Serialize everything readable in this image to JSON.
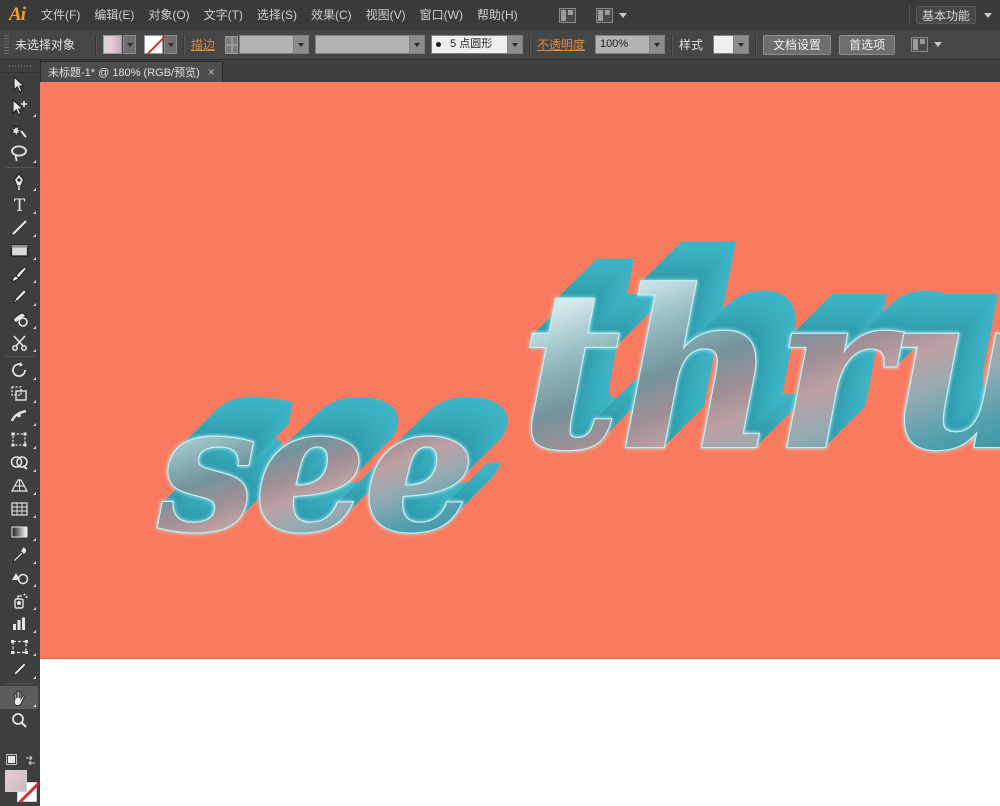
{
  "app": {
    "name": "Adobe Illustrator",
    "logo_text": "Ai"
  },
  "menubar": {
    "items": [
      {
        "label": "文件(F)",
        "name": "menu-file"
      },
      {
        "label": "编辑(E)",
        "name": "menu-edit"
      },
      {
        "label": "对象(O)",
        "name": "menu-object"
      },
      {
        "label": "文字(T)",
        "name": "menu-type"
      },
      {
        "label": "选择(S)",
        "name": "menu-select"
      },
      {
        "label": "效果(C)",
        "name": "menu-effect"
      },
      {
        "label": "视图(V)",
        "name": "menu-view"
      },
      {
        "label": "窗口(W)",
        "name": "menu-window"
      },
      {
        "label": "帮助(H)",
        "name": "menu-help"
      }
    ],
    "bridge_icon": "bridge-icon",
    "arrange_icon": "arrange-documents-icon",
    "workspace": "基本功能"
  },
  "controlbar": {
    "selection_status": "未选择对象",
    "fill_label": "fill-swatch",
    "stroke_label": "stroke-swatch",
    "stroke_text": "描边",
    "stroke_weight": "",
    "stroke_profile": "",
    "brush_definition": "5 点圆形",
    "opacity_label": "不透明度",
    "opacity_value": "100%",
    "style_label": "样式",
    "document_setup": "文档设置",
    "preferences": "首选项",
    "align_icon": "align-dropdown-icon"
  },
  "tabbar": {
    "tab_title": "未标题-1* @ 180% (RGB/预览)",
    "close_glyph": "×"
  },
  "toolbar": {
    "tools": [
      {
        "name": "selection-tool",
        "label": "选择工具"
      },
      {
        "name": "direct-selection-tool",
        "label": "直接选择工具"
      },
      {
        "name": "magic-wand-tool",
        "label": "魔棒工具"
      },
      {
        "name": "lasso-tool",
        "label": "套索工具"
      },
      {
        "name": "pen-tool",
        "label": "钢笔工具"
      },
      {
        "name": "type-tool",
        "label": "文字工具"
      },
      {
        "name": "line-segment-tool",
        "label": "直线段工具"
      },
      {
        "name": "rectangle-tool",
        "label": "矩形工具"
      },
      {
        "name": "paintbrush-tool",
        "label": "画笔工具"
      },
      {
        "name": "pencil-tool",
        "label": "铅笔工具"
      },
      {
        "name": "blob-brush-tool",
        "label": "斑点画笔工具"
      },
      {
        "name": "eraser-tool",
        "label": "橡皮擦工具"
      },
      {
        "name": "scissors-tool",
        "label": "剪刀工具"
      },
      {
        "name": "rotate-tool",
        "label": "旋转工具"
      },
      {
        "name": "scale-tool",
        "label": "比例缩放工具"
      },
      {
        "name": "width-tool",
        "label": "宽度工具"
      },
      {
        "name": "free-transform-tool",
        "label": "自由变换工具"
      },
      {
        "name": "shape-builder-tool",
        "label": "形状生成器工具"
      },
      {
        "name": "perspective-grid-tool",
        "label": "透视网格工具"
      },
      {
        "name": "mesh-tool",
        "label": "网格工具"
      },
      {
        "name": "gradient-tool",
        "label": "渐变工具"
      },
      {
        "name": "eyedropper-tool",
        "label": "吸管工具"
      },
      {
        "name": "blend-tool",
        "label": "混合工具"
      },
      {
        "name": "symbol-sprayer-tool",
        "label": "符号喷枪工具"
      },
      {
        "name": "column-graph-tool",
        "label": "柱形图工具"
      },
      {
        "name": "artboard-tool",
        "label": "画板工具"
      },
      {
        "name": "slice-tool",
        "label": "切片工具"
      },
      {
        "name": "hand-tool",
        "label": "抓手工具",
        "active": true
      },
      {
        "name": "zoom-tool",
        "label": "缩放工具"
      }
    ],
    "fill_color": "#dcc6cc",
    "stroke_color": "none"
  },
  "canvas": {
    "artboard_color": "#fa7a5f",
    "artwork": {
      "word_1": "see",
      "word_2": "thru",
      "face_highlight": "#bdf2f7",
      "body_color": "#2f96a6",
      "shadow_color": "#c44834"
    }
  }
}
